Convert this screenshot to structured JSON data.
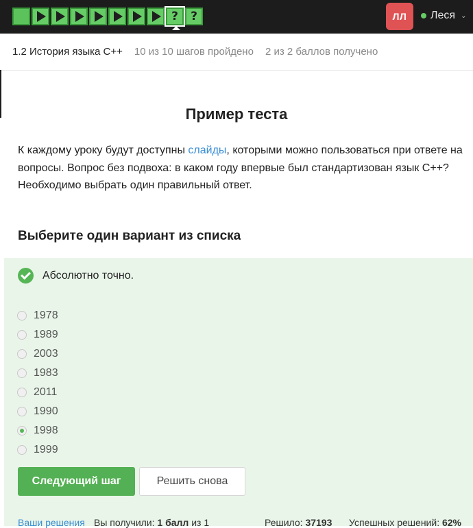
{
  "nav": {
    "steps": [
      {
        "kind": "theory",
        "icon": "filled-square-icon"
      },
      {
        "kind": "play",
        "icon": "play-icon"
      },
      {
        "kind": "play",
        "icon": "play-icon"
      },
      {
        "kind": "play",
        "icon": "play-icon"
      },
      {
        "kind": "play",
        "icon": "play-icon"
      },
      {
        "kind": "play",
        "icon": "play-icon"
      },
      {
        "kind": "play",
        "icon": "play-icon"
      },
      {
        "kind": "play",
        "icon": "play-icon"
      },
      {
        "kind": "quiz",
        "icon": "question-icon",
        "label": "?",
        "current": true
      },
      {
        "kind": "quiz",
        "icon": "question-icon",
        "label": "?"
      }
    ],
    "colors": {
      "step_fill": "#66cc66",
      "bar_bg": "#1c1c1c",
      "accent": "#54b054"
    }
  },
  "user": {
    "initials": "ЛЛ",
    "name": "Леся",
    "avatar_color": "#e05355"
  },
  "lesson": {
    "title": "1.2 История языка C++",
    "steps_progress": "10 из 10 шагов пройдено",
    "score": "2 из 2 баллов  получено"
  },
  "content": {
    "heading": "Пример теста",
    "para_before": "К каждому уроку будут доступны ",
    "para_link": "слайды",
    "para_after": ", которыми можно пользоваться при ответе на вопросы. Вопрос без подвоха: в каком году впервые был стандартизован язык C++? Необходимо выбрать один правильный ответ.",
    "subheading": "Выберите один вариант из списка"
  },
  "quiz": {
    "status": "Абсолютно точно.",
    "options": [
      {
        "label": "1978",
        "checked": false
      },
      {
        "label": "1989",
        "checked": false
      },
      {
        "label": "2003",
        "checked": false
      },
      {
        "label": "1983",
        "checked": false
      },
      {
        "label": "2011",
        "checked": false
      },
      {
        "label": "1990",
        "checked": false
      },
      {
        "label": "1998",
        "checked": true
      },
      {
        "label": "1999",
        "checked": false
      }
    ],
    "next_label": "Следующий шаг",
    "retry_label": "Решить снова"
  },
  "footer": {
    "solutions_link": "Ваши решения",
    "received_prefix": "Вы получили: ",
    "received_value": "1 балл",
    "received_suffix": " из 1",
    "solved_label": "Решило: ",
    "solved_value": "37193",
    "success_label": "Успешных решений: ",
    "success_value": "62%"
  }
}
